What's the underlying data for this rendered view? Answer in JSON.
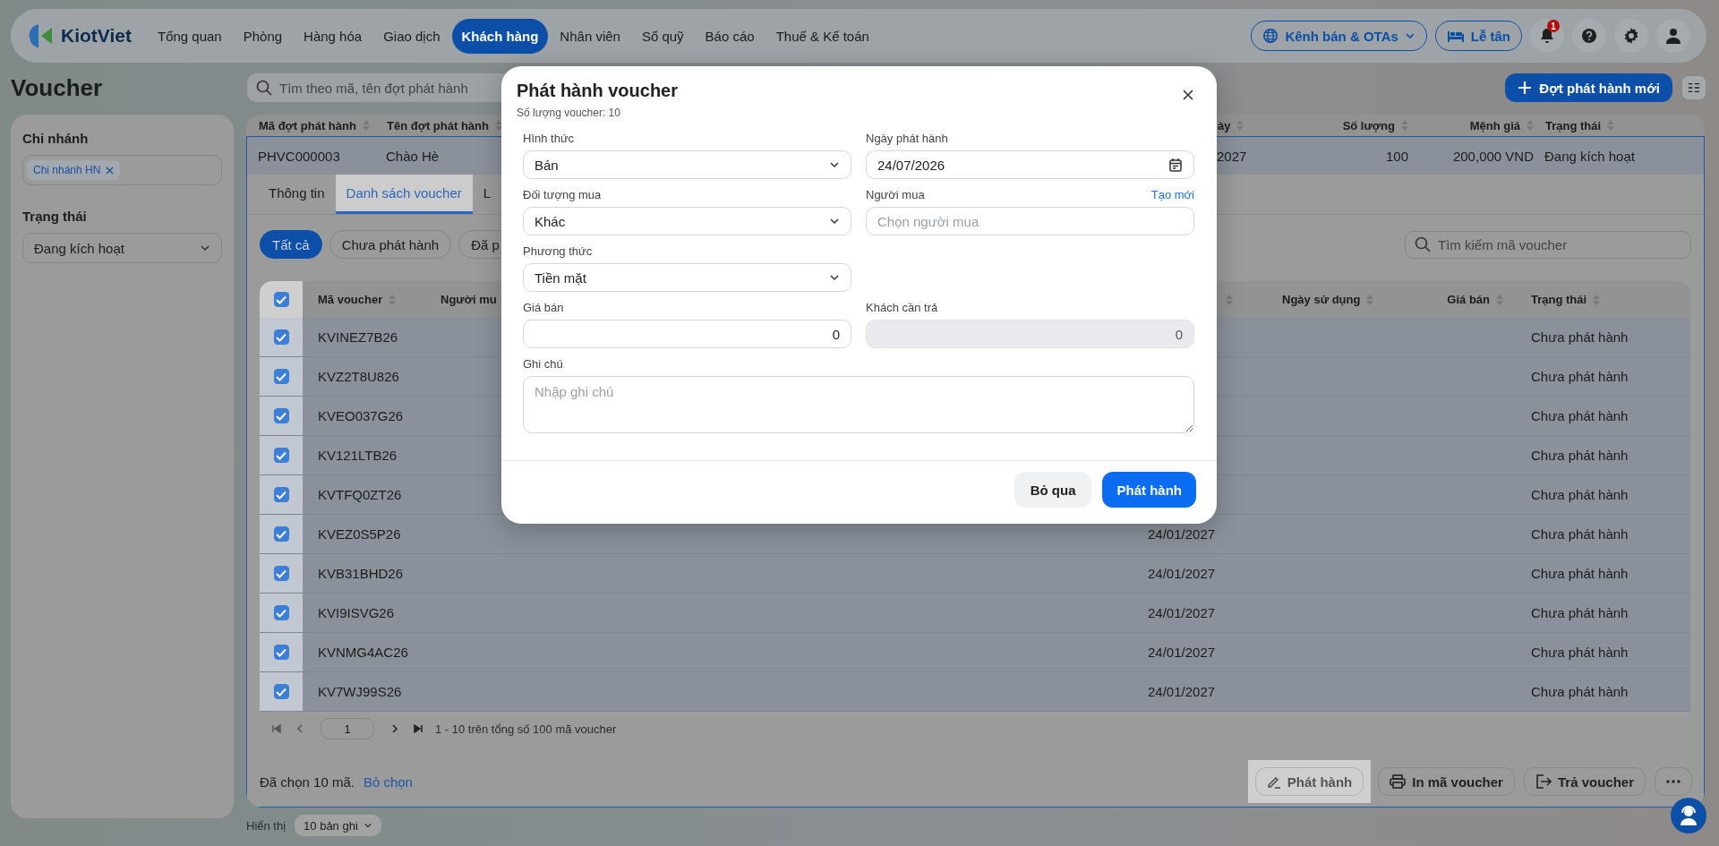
{
  "nav": {
    "brand": "KiotViet",
    "items": [
      {
        "label": "Tổng quan",
        "selected": false
      },
      {
        "label": "Phòng",
        "selected": false
      },
      {
        "label": "Hàng hóa",
        "selected": false
      },
      {
        "label": "Giao dịch",
        "selected": false
      },
      {
        "label": "Khách hàng",
        "selected": true
      },
      {
        "label": "Nhân viên",
        "selected": false
      },
      {
        "label": "Sổ quỹ",
        "selected": false
      },
      {
        "label": "Báo cáo",
        "selected": false
      },
      {
        "label": "Thuế & Kế toán",
        "selected": false
      }
    ],
    "channel_button": "Kênh bán & OTAs",
    "reception_button": "Lễ tân",
    "notification_count": "1"
  },
  "page": {
    "title": "Voucher",
    "search_placeholder": "Tìm theo mã, tên đợt phát hành",
    "new_button": "Đợt phát hành mới"
  },
  "sidebar": {
    "branch_label": "Chi nhánh",
    "branch_tags": [
      "Chi nhánh HN"
    ],
    "status_label": "Trạng thái",
    "status_value": "Đang kích hoạt"
  },
  "campaign_table": {
    "columns": [
      "Mã đợt phát hành",
      "Tên đợt phát hành",
      "ày",
      "Số lượng",
      "Mệnh giá",
      "Trạng thái"
    ],
    "rows": [
      {
        "cells": [
          "PHVC000003",
          "Chào Hè",
          "2027",
          "100",
          "200,000 VND",
          "Đang kích hoạt"
        ],
        "selected": true
      }
    ]
  },
  "detail": {
    "tabs": [
      {
        "label": "Thông tin",
        "selected": false
      },
      {
        "label": "Danh sách voucher",
        "selected": true
      },
      {
        "label": "L",
        "selected": false
      }
    ],
    "chips": [
      {
        "label": "Tất cả",
        "selected": true
      },
      {
        "label": "Chưa phát hành",
        "selected": false
      },
      {
        "label": "Đã p",
        "selected": false
      }
    ],
    "search_placeholder": "Tìm kiếm mã voucher",
    "all_checked": true,
    "columns": [
      "Mã voucher",
      "Người mu",
      "Ngày sử dụng",
      "Giá bán",
      "Trạng thái"
    ],
    "rows": [
      {
        "code": "KVINEZ7B26",
        "checked": true,
        "status": "Chưa phát hành"
      },
      {
        "code": "KVZ2T8U826",
        "checked": true,
        "status": "Chưa phát hành"
      },
      {
        "code": "KVEO037G26",
        "checked": true,
        "status": "Chưa phát hành"
      },
      {
        "code": "KV121LTB26",
        "checked": true,
        "status": "Chưa phát hành"
      },
      {
        "code": "KVTFQ0ZT26",
        "checked": true,
        "status": "Chưa phát hành"
      },
      {
        "code": "KVEZ0S5P26",
        "checked": true,
        "date": "24/01/2027",
        "status": "Chưa phát hành"
      },
      {
        "code": "KVB31BHD26",
        "checked": true,
        "date": "24/01/2027",
        "status": "Chưa phát hành"
      },
      {
        "code": "KVI9ISVG26",
        "checked": true,
        "date": "24/01/2027",
        "status": "Chưa phát hành"
      },
      {
        "code": "KVNMG4AC26",
        "checked": true,
        "date": "24/01/2027",
        "status": "Chưa phát hành"
      },
      {
        "code": "KV7WJ99S26",
        "checked": true,
        "date": "24/01/2027",
        "status": "Chưa phát hành"
      }
    ],
    "pagination": {
      "page": "1",
      "summary": "1 - 10 trên tổng số 100 mã voucher"
    },
    "selection_text": "Đã chọn 10 mã.",
    "clear_link": "Bỏ chọn",
    "actions": [
      {
        "kind": "issue",
        "label": "Phát hành",
        "highlighted": true
      },
      {
        "kind": "print",
        "label": "In mã voucher",
        "highlighted": false
      },
      {
        "kind": "return",
        "label": "Trả voucher",
        "highlighted": false
      },
      {
        "kind": "more",
        "highlighted": false
      }
    ]
  },
  "page_size": {
    "label": "Hiển thị",
    "value": "10 bản ghi"
  },
  "modal": {
    "title": "Phát hành voucher",
    "subtitle": "Số lượng voucher: 10",
    "rows": [
      [
        {
          "label": "Hình thức",
          "kind": "select",
          "value": "Bán"
        },
        {
          "label": "Ngày phát hành",
          "kind": "date",
          "value": "24/07/2026"
        }
      ],
      [
        {
          "label": "Đối tượng mua",
          "kind": "select",
          "value": "Khác"
        },
        {
          "label": "Người mua",
          "kind": "text",
          "placeholder": "Chọn người mua",
          "link": "Tạo mới"
        }
      ],
      [
        {
          "label": "Phương thức",
          "kind": "select",
          "value": "Tiền mặt"
        }
      ],
      [
        {
          "label": "Giá bán",
          "kind": "number",
          "value": "0",
          "disabled": false
        },
        {
          "label": "Khách cần trả",
          "kind": "number",
          "value": "0",
          "disabled": true
        }
      ],
      [
        {
          "label": "Ghi chú",
          "kind": "textarea",
          "placeholder": "Nhập ghi chú"
        }
      ]
    ],
    "cancel_button": "Bỏ qua",
    "submit_button": "Phát hành"
  }
}
